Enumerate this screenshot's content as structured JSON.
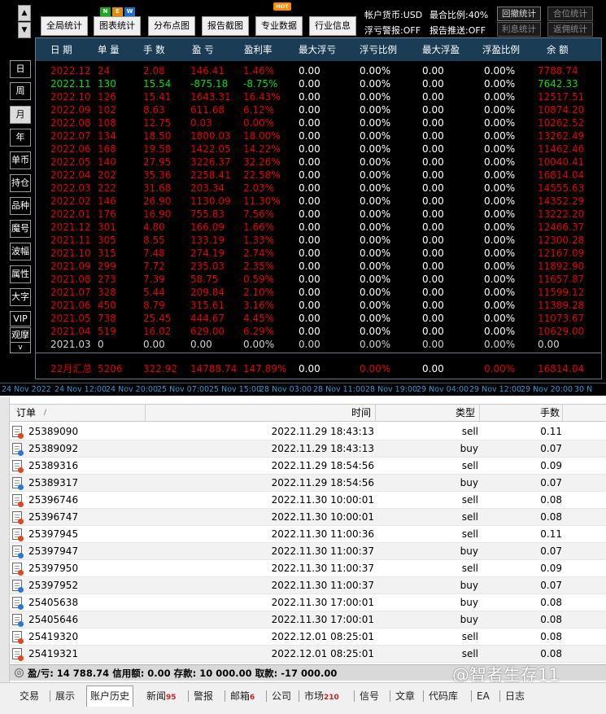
{
  "top_buttons": {
    "global_stats": "全局统计",
    "chart_stats": "图表统计",
    "distribution": "分布点图",
    "report_shot": "报告截图",
    "pro_data": "专业数据",
    "industry_info": "行业信息",
    "new_badge": [
      "N",
      "E",
      "W"
    ],
    "hot_badge": "HOT",
    "up_arrow": "▲",
    "down_arrow": "▼"
  },
  "account_info": {
    "currency": "帐户货币:USD",
    "ratio": "最合比例:40%",
    "float_alert": "浮亏警报:OFF",
    "report_push": "报告推送:OFF"
  },
  "right_buttons": {
    "backtest": "回撤统计",
    "position": "合位统计",
    "interest": "利息统计",
    "rebate": "返佣统计"
  },
  "side_tabs": [
    "日",
    "周",
    "月",
    "年",
    "单币",
    "持仓",
    "品种",
    "魔号",
    "波幅",
    "属性",
    "大字",
    "VIP",
    "观摩"
  ],
  "side_scroll": "v",
  "table": {
    "headers": [
      "日 期",
      "单 量",
      "手 数",
      "盈 亏",
      "盈利率",
      "最大浮亏",
      "浮亏比例",
      "最大浮盈",
      "浮盈比例",
      "余 额"
    ],
    "rows": [
      [
        "2022.12",
        "24",
        "2.08",
        "146.41",
        "1.46%",
        "0.00",
        "0.00%",
        "0.00",
        "0.00%",
        "7788.74"
      ],
      [
        "2022.11",
        "130",
        "15.54",
        "-875.18",
        "-8.75%",
        "0.00",
        "0.00%",
        "0.00",
        "0.00%",
        "7642.33"
      ],
      [
        "2022.10",
        "126",
        "15.41",
        "1643.31",
        "16.43%",
        "0.00",
        "0.00%",
        "0.00",
        "0.00%",
        "12517.51"
      ],
      [
        "2022.09",
        "102",
        "8.63",
        "611.68",
        "6.12%",
        "0.00",
        "0.00%",
        "0.00",
        "0.00%",
        "10874.20"
      ],
      [
        "2022.08",
        "108",
        "12.75",
        "0.03",
        "0.00%",
        "0.00",
        "0.00%",
        "0.00",
        "0.00%",
        "10262.52"
      ],
      [
        "2022.07",
        "134",
        "18.50",
        "1800.03",
        "18.00%",
        "0.00",
        "0.00%",
        "0.00",
        "0.00%",
        "13262.49"
      ],
      [
        "2022.06",
        "168",
        "19.58",
        "1422.05",
        "14.22%",
        "0.00",
        "0.00%",
        "0.00",
        "0.00%",
        "11462.46"
      ],
      [
        "2022.05",
        "140",
        "27.95",
        "3226.37",
        "32.26%",
        "0.00",
        "0.00%",
        "0.00",
        "0.00%",
        "10040.41"
      ],
      [
        "2022.04",
        "202",
        "35.36",
        "2258.41",
        "22.58%",
        "0.00",
        "0.00%",
        "0.00",
        "0.00%",
        "16814.04"
      ],
      [
        "2022.03",
        "222",
        "31.68",
        "203.34",
        "2.03%",
        "0.00",
        "0.00%",
        "0.00",
        "0.00%",
        "14555.63"
      ],
      [
        "2022.02",
        "146",
        "26.90",
        "1130.09",
        "11.30%",
        "0.00",
        "0.00%",
        "0.00",
        "0.00%",
        "14352.29"
      ],
      [
        "2022.01",
        "176",
        "16.90",
        "755.83",
        "7.56%",
        "0.00",
        "0.00%",
        "0.00",
        "0.00%",
        "13222.20"
      ],
      [
        "2021.12",
        "301",
        "4.80",
        "166.09",
        "1.66%",
        "0.00",
        "0.00%",
        "0.00",
        "0.00%",
        "12466.37"
      ],
      [
        "2021.11",
        "305",
        "8.55",
        "133.19",
        "1.33%",
        "0.00",
        "0.00%",
        "0.00",
        "0.00%",
        "12300.28"
      ],
      [
        "2021.10",
        "315",
        "7.48",
        "274.19",
        "2.74%",
        "0.00",
        "0.00%",
        "0.00",
        "0.00%",
        "12167.09"
      ],
      [
        "2021.09",
        "299",
        "7.72",
        "235.03",
        "2.35%",
        "0.00",
        "0.00%",
        "0.00",
        "0.00%",
        "11892.90"
      ],
      [
        "2021.08",
        "273",
        "7.39",
        "58.75",
        "0.59%",
        "0.00",
        "0.00%",
        "0.00",
        "0.00%",
        "11657.87"
      ],
      [
        "2021.07",
        "328",
        "5.44",
        "209.84",
        "2.10%",
        "0.00",
        "0.00%",
        "0.00",
        "0.00%",
        "11599.12"
      ],
      [
        "2021.06",
        "450",
        "8.79",
        "315.61",
        "3.16%",
        "0.00",
        "0.00%",
        "0.00",
        "0.00%",
        "11389.28"
      ],
      [
        "2021.05",
        "738",
        "25.45",
        "444.67",
        "4.45%",
        "0.00",
        "0.00%",
        "0.00",
        "0.00%",
        "11073.67"
      ],
      [
        "2021.04",
        "519",
        "16.02",
        "629.00",
        "6.29%",
        "0.00",
        "0.00%",
        "0.00",
        "0.00%",
        "10629.00"
      ],
      [
        "2021.03",
        "0",
        "0.00",
        "0.00",
        "0.00%",
        "0.00",
        "0.00%",
        "0.00",
        "0.00%",
        "0.00"
      ]
    ],
    "summary": [
      "22月汇总",
      "5206",
      "322.92",
      "14788.74",
      "147.89%",
      "0.00",
      "0.00%",
      "0.00",
      "0.00%",
      "16814.04"
    ]
  },
  "time_axis": [
    "24 Nov 2022",
    "24 Nov 12:00",
    "24 Nov 20:00",
    "25 Nov 07:00",
    "25 Nov 15:00",
    "28 Nov 03:00",
    "28 Nov 11:00",
    "28 Nov 19:00",
    "29 Nov 04:00",
    "29 Nov 12:00",
    "29 Nov 20:00",
    "30 N"
  ],
  "history": {
    "headers": {
      "order": "订单",
      "sort": "/",
      "time": "时间",
      "type": "类型",
      "lots": "手数"
    },
    "rows": [
      [
        "25389090",
        "2022.11.29 18:43:13",
        "sell",
        "0.11"
      ],
      [
        "25389092",
        "2022.11.29 18:43:13",
        "buy",
        "0.07"
      ],
      [
        "25389316",
        "2022.11.29 18:54:56",
        "sell",
        "0.09"
      ],
      [
        "25389317",
        "2022.11.29 18:54:56",
        "buy",
        "0.07"
      ],
      [
        "25396746",
        "2022.11.30 10:00:01",
        "sell",
        "0.08"
      ],
      [
        "25396747",
        "2022.11.30 10:00:01",
        "sell",
        "0.08"
      ],
      [
        "25397945",
        "2022.11.30 11:00:36",
        "sell",
        "0.11"
      ],
      [
        "25397947",
        "2022.11.30 11:00:37",
        "buy",
        "0.07"
      ],
      [
        "25397950",
        "2022.11.30 11:00:37",
        "sell",
        "0.09"
      ],
      [
        "25397952",
        "2022.11.30 11:00:37",
        "buy",
        "0.07"
      ],
      [
        "25405638",
        "2022.11.30 17:00:01",
        "buy",
        "0.08"
      ],
      [
        "25405646",
        "2022.11.30 17:00:01",
        "buy",
        "0.08"
      ],
      [
        "25419320",
        "2022.12.01 08:25:01",
        "sell",
        "0.08"
      ],
      [
        "25419321",
        "2022.12.01 08:25:01",
        "sell",
        "0.08"
      ]
    ],
    "summary": "盈/亏: 14 788.74  信用额: 0.00  存款: 10 000.00  取款: -17 000.00"
  },
  "tabs": [
    {
      "label": "交易",
      "count": ""
    },
    {
      "label": "展示",
      "count": ""
    },
    {
      "label": "账户历史",
      "count": ""
    },
    {
      "label": "新闻",
      "count": "95"
    },
    {
      "label": "警报",
      "count": ""
    },
    {
      "label": "邮箱",
      "count": "6"
    },
    {
      "label": "公司",
      "count": ""
    },
    {
      "label": "市场",
      "count": "210"
    },
    {
      "label": "信号",
      "count": ""
    },
    {
      "label": "文章",
      "count": ""
    },
    {
      "label": "代码库",
      "count": ""
    },
    {
      "label": "EA",
      "count": ""
    },
    {
      "label": "日志",
      "count": ""
    }
  ],
  "watermark": "@智者生存11",
  "colors": {
    "header_bg": "#1a3c54",
    "profit": "#e60000",
    "current": "#00e000",
    "axis": "#2f9ad8"
  }
}
